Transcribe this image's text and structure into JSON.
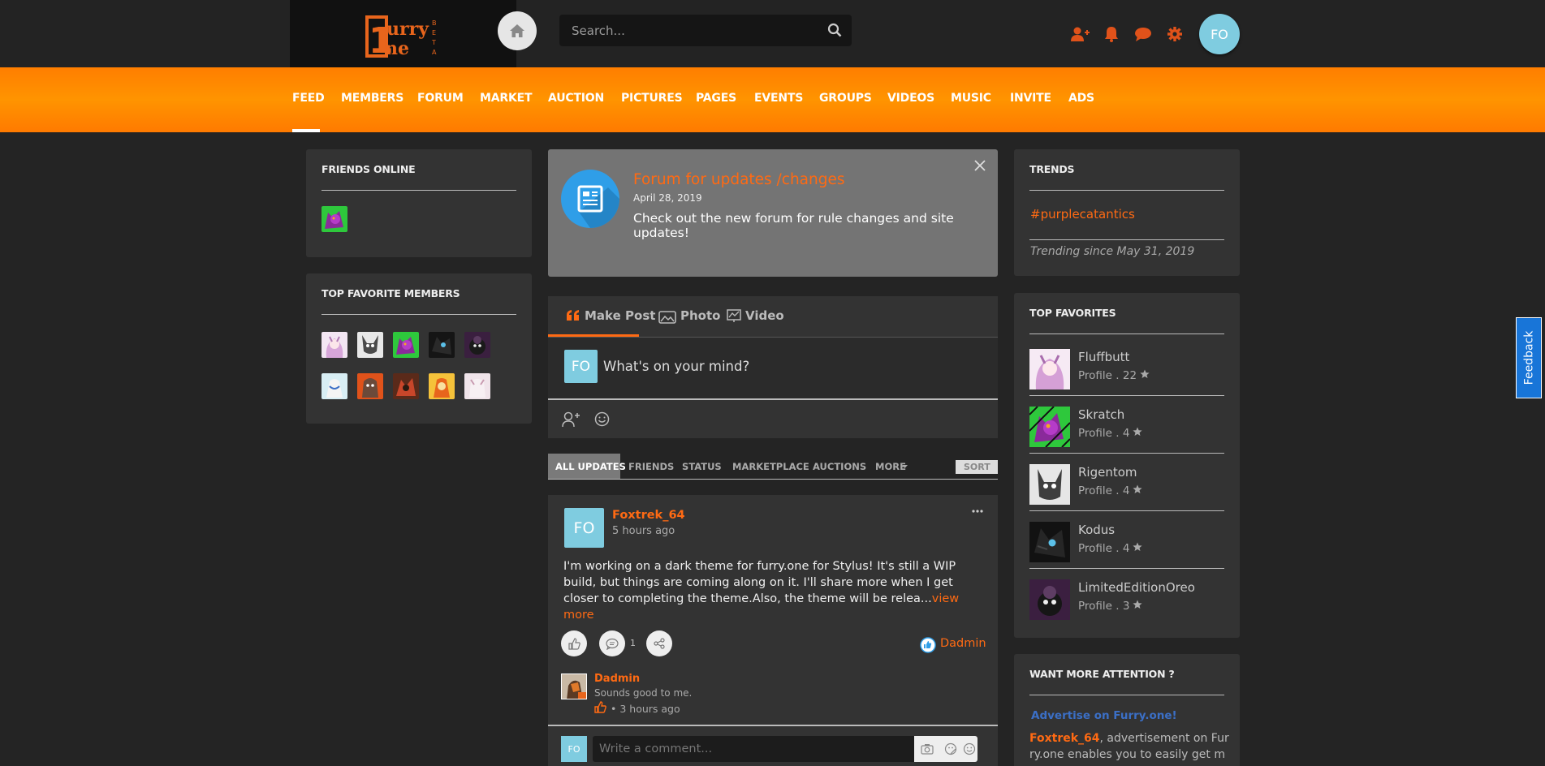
{
  "header": {
    "logo_text": "Furry One BETA",
    "search_placeholder": "Search...",
    "avatar_initials": "FO"
  },
  "nav": [
    "FEED",
    "MEMBERS",
    "FORUM",
    "MARKET",
    "AUCTION",
    "PICTURES",
    "PAGES",
    "EVENTS",
    "GROUPS",
    "VIDEOS",
    "MUSIC",
    "INVITE",
    "ADS"
  ],
  "left": {
    "friends_online_title": "FRIENDS ONLINE",
    "top_favorite_members_title": "TOP FAVORITE MEMBERS"
  },
  "announcement": {
    "title": "Forum for updates /changes",
    "date": "April 28, 2019",
    "text": "Check out the new forum for rule changes and site updates!"
  },
  "composer": {
    "tabs": [
      "Make Post",
      "Photo",
      "Video"
    ],
    "avatar_initials": "FO",
    "placeholder": "What's on your mind?"
  },
  "filters": {
    "items": [
      "ALL UPDATES",
      "FRIENDS",
      "STATUS",
      "MARKETPLACE",
      "AUCTIONS",
      "MORE"
    ],
    "sort": "SORT"
  },
  "post": {
    "avatar_initials": "FO",
    "author": "Foxtrek_64",
    "time": "5 hours ago",
    "text": "I'm working on a dark theme for furry.one for Stylus! It's still a WIP build, but things are coming along on it. I'll share more when I get closer to completing the theme.Also, the theme will be relea...",
    "view_more": "view more",
    "comment_count": "1",
    "liked_by": "Dadmin",
    "comment": {
      "author": "Dadmin",
      "text": "Sounds good to me.",
      "time": "• 3 hours ago"
    },
    "comment_avatar_initials": "FO",
    "comment_placeholder": "Write a comment..."
  },
  "trends": {
    "title": "TRENDS",
    "tag": "#purplecatantics",
    "since": "Trending since May 31, 2019"
  },
  "top_favorites": {
    "title": "TOP FAVORITES",
    "items": [
      {
        "name": "Fluffbutt",
        "sub": "Profile . 22"
      },
      {
        "name": "Skratch",
        "sub": "Profile . 4"
      },
      {
        "name": "Rigentom",
        "sub": "Profile . 4"
      },
      {
        "name": "Kodus",
        "sub": "Profile . 4"
      },
      {
        "name": "LimitedEditionOreo",
        "sub": "Profile . 3"
      }
    ]
  },
  "attention": {
    "title": "WANT MORE ATTENTION ?",
    "link": "Advertise on Furry.one!",
    "user": "Foxtrek_64",
    "text1": ", advertisement on Fur",
    "text2": "ry.one enables you to easily get m"
  },
  "feedback": "Feedback",
  "colors": {
    "accent": "#ff6a13",
    "nav": "#ff8600",
    "bg": "#242424",
    "panel": "#333333",
    "avatar": "#7fcce0"
  }
}
